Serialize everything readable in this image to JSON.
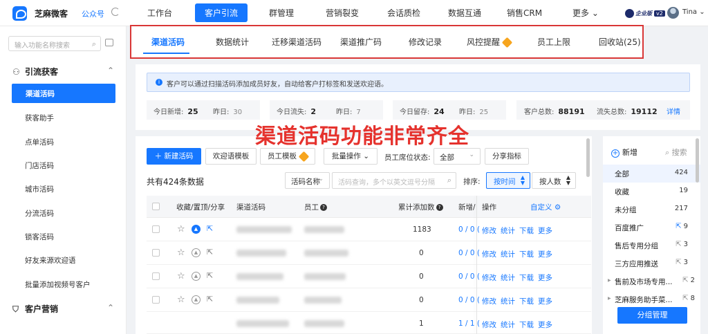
{
  "header": {
    "brand": "芝麻微客",
    "public_account": "公众号",
    "nav": [
      "工作台",
      "客户引流",
      "群管理",
      "营销裂变",
      "会话质检",
      "数据互通",
      "销售CRM",
      "更多"
    ],
    "active_nav": "客户引流",
    "enterprise_badge": "企业版",
    "version": "v2",
    "user": "Tina"
  },
  "sidebar": {
    "search_placeholder": "输入功能名称搜索",
    "group1": "引流获客",
    "items": [
      "渠道活码",
      "获客助手",
      "点单活码",
      "门店活码",
      "城市活码",
      "分流活码",
      "锁客活码",
      "好友来源欢迎语",
      "批量添加视频号客户"
    ],
    "group2": "客户营销"
  },
  "tabs": [
    "渠道活码",
    "数据统计",
    "迁移渠道活码",
    "渠道推广码",
    "修改记录",
    "风控提醒",
    "员工上限",
    "回收站(25)"
  ],
  "info": "客户可以通过扫描活码添加成员好友，自动给客户打标签和发送欢迎语。",
  "stats": {
    "today_new_label": "今日新增:",
    "today_new": "25",
    "yest_new_label": "昨日:",
    "yest_new": "30",
    "today_loss_label": "今日流失:",
    "today_loss": "2",
    "yest_loss_label": "昨日:",
    "yest_loss": "7",
    "today_keep_label": "今日留存:",
    "today_keep": "24",
    "yest_keep_label": "昨日:",
    "yest_keep": "25",
    "total_cust_label": "客户总数:",
    "total_cust": "88191",
    "total_loss_label": "流失总数:",
    "total_loss": "19112",
    "detail": "详情"
  },
  "overlay_text": "渠道活码功能非常齐全",
  "toolbar": {
    "new": "新建活码",
    "welcome": "欢迎语模板",
    "staff": "员工模板",
    "batch": "批量操作",
    "seat_label": "员工席位状态:",
    "seat_value": "全部",
    "share": "分享指标"
  },
  "list": {
    "total": "共有424条数据",
    "search_field": "活码名称",
    "search_placeholder": "活码查询，多个以英文逗号分隔",
    "sort_label": "排序:",
    "sort_time": "按时间",
    "sort_person": "按人数"
  },
  "table": {
    "headers": [
      "收藏/置顶/分享",
      "渠道活码",
      "员工",
      "累计添加数",
      "新增/",
      "操作",
      "自定义"
    ],
    "rows": [
      {
        "count": "1183",
        "ratio": "0 / 0 ("
      },
      {
        "count": "0",
        "ratio": "0 / 0 ("
      },
      {
        "count": "0",
        "ratio": "0 / 0 ("
      },
      {
        "count": "0",
        "ratio": "0 / 0 ("
      },
      {
        "count": "1",
        "ratio": "1 / 1 ("
      }
    ],
    "actions": [
      "修改",
      "统计",
      "下载",
      "更多"
    ]
  },
  "groups_panel": {
    "new": "新增",
    "search": "搜索",
    "items": [
      {
        "name": "全部",
        "count": "424"
      },
      {
        "name": "收藏",
        "count": "19"
      },
      {
        "name": "未分组",
        "count": "217"
      },
      {
        "name": "百度推广",
        "count": "9"
      },
      {
        "name": "售后专用分组",
        "count": "3"
      },
      {
        "name": "三方应用推送",
        "count": "3"
      },
      {
        "name": "售前及市场专用...",
        "count": "2"
      },
      {
        "name": "芝麻服务助手菜...",
        "count": "8"
      }
    ],
    "manage": "分组管理"
  },
  "colors": {
    "accent": "#1677ff",
    "highlight_border": "#d93636",
    "overlay_text": "#e5322d",
    "gem": "#f7a51e"
  }
}
